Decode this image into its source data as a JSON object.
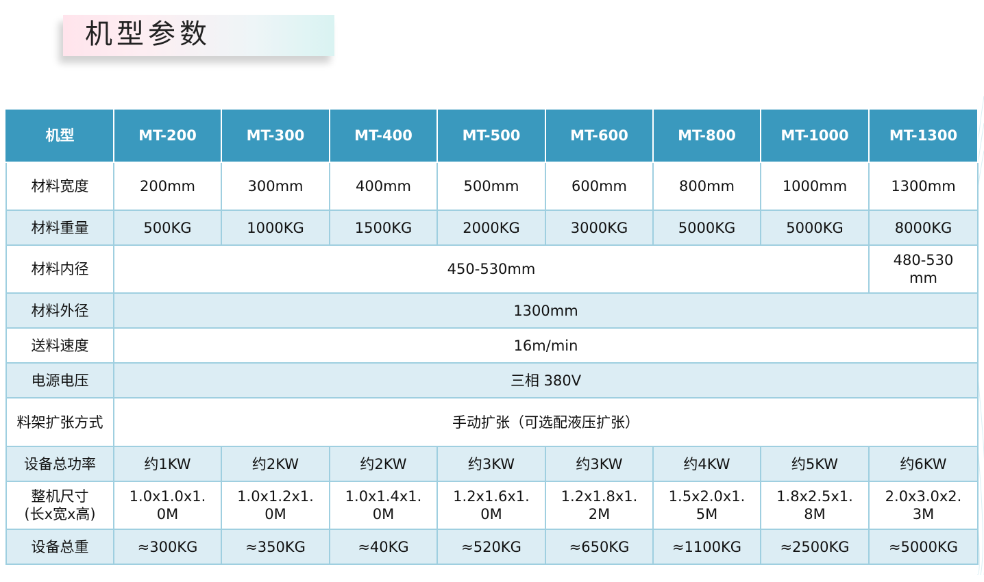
{
  "title": "机型参数",
  "colors": {
    "header_bg": "#3a99be",
    "row_blue": "#dcedf4",
    "border": "#9fcfe0"
  },
  "header": {
    "label": "机型",
    "models": [
      "MT-200",
      "MT-300",
      "MT-400",
      "MT-500",
      "MT-600",
      "MT-800",
      "MT-1000",
      "MT-1300"
    ]
  },
  "rows": {
    "width": {
      "label": "材料宽度",
      "values": [
        "200mm",
        "300mm",
        "400mm",
        "500mm",
        "600mm",
        "800mm",
        "1000mm",
        "1300mm"
      ]
    },
    "weight": {
      "label": "材料重量",
      "values": [
        "500KG",
        "1000KG",
        "1500KG",
        "2000KG",
        "3000KG",
        "5000KG",
        "5000KG",
        "8000KG"
      ]
    },
    "inner": {
      "label": "材料内径",
      "main": "450-530mm",
      "last": "480-530mm"
    },
    "outer": {
      "label": "材料外径",
      "value": "1300mm"
    },
    "speed": {
      "label": "送料速度",
      "value": "16m/min"
    },
    "voltage": {
      "label": "电源电压",
      "value": "三相 380V"
    },
    "expand": {
      "label": "料架扩张方式",
      "value": "手动扩张（可选配液压扩张）"
    },
    "power": {
      "label": "设备总功率",
      "values": [
        "约1KW",
        "约2KW",
        "约2KW",
        "约3KW",
        "约3KW",
        "约4KW",
        "约5KW",
        "约6KW"
      ]
    },
    "size": {
      "label": "整机尺寸(长x宽x高)",
      "values": [
        "1.0x1.0x1.0M",
        "1.0x1.2x1.0M",
        "1.0x1.4x1.0M",
        "1.2x1.6x1.0M",
        "1.2x1.8x1.2M",
        "1.5x2.0x1.5M",
        "1.8x2.5x1.8M",
        "2.0x3.0x2.3M"
      ]
    },
    "total_weight": {
      "label": "设备总重",
      "values": [
        "≈300KG",
        "≈350KG",
        "≈40KG",
        "≈520KG",
        "≈650KG",
        "≈1100KG",
        "≈2500KG",
        "≈5000KG"
      ]
    }
  }
}
